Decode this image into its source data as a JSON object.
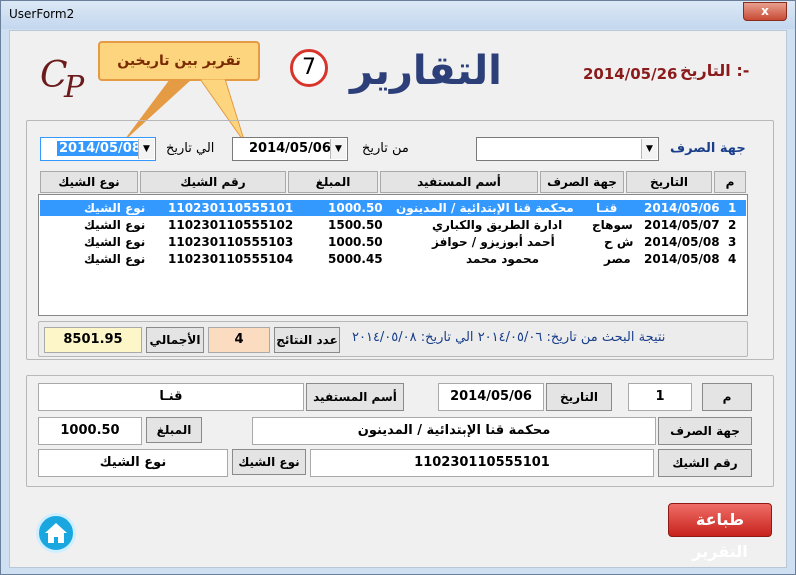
{
  "window": {
    "title": "UserForm2",
    "close_label": "x"
  },
  "header": {
    "logo_text": "CP",
    "callout": "تقرير بين تاريخين",
    "badge": "7",
    "title": "التقارير",
    "date_label": "التاريخ :-",
    "date_value": "2014/05/26"
  },
  "filters": {
    "expense_label": "جهة الصرف",
    "expense_value": "",
    "from_label": "من تاريخ",
    "from_value": "2014/05/06",
    "to_label": "الي تاريخ",
    "to_value": "2014/05/08"
  },
  "table": {
    "columns": [
      "م",
      "التاريخ",
      "جهة الصرف",
      "أسم المستفيد",
      "المبلغ",
      "رقم الشيك",
      "نوع الشيك"
    ],
    "rows": [
      {
        "n": "1",
        "date": "2014/05/06",
        "dept": "قنـا",
        "beneficiary": "محكمة قنا الإبتدائية / المدينون",
        "amount": "1000.50",
        "cheque": "110230110555101",
        "type": "نوع الشيك"
      },
      {
        "n": "2",
        "date": "2014/05/07",
        "dept": "سوهاج",
        "beneficiary": "ادارة الطريق والكباري",
        "amount": "1500.50",
        "cheque": "110230110555102",
        "type": "نوع الشيك"
      },
      {
        "n": "3",
        "date": "2014/05/08",
        "dept": "ش ح",
        "beneficiary": "أحمد أبوزيزو / حوافز",
        "amount": "1000.50",
        "cheque": "110230110555103",
        "type": "نوع الشيك"
      },
      {
        "n": "4",
        "date": "2014/05/08",
        "dept": "مصر",
        "beneficiary": "محمود محمد",
        "amount": "5000.45",
        "cheque": "110230110555104",
        "type": "نوع الشيك"
      }
    ]
  },
  "summary": {
    "result_text": "نتيجة البحث من تاريخ: ٢٠١٤/٠٥/٠٦ الي تاريخ: ٢٠١٤/٠٥/٠٨",
    "count_label": "عدد النتائج",
    "count_value": "4",
    "total_label": "الأجمالي",
    "total_value": "8501.95"
  },
  "detail": {
    "m_label": "م",
    "m_value": "1",
    "date_label": "التاريخ",
    "date_value": "2014/05/06",
    "beneficiary_label": "أسم المستفيد",
    "beneficiary_value": "قنـا",
    "dept_label": "جهة الصرف",
    "dept_value": "محكمة قنا الإبتدائية / المدينون",
    "amount_label": "المبلغ",
    "amount_value": "1000.50",
    "cheque_label": "رقم الشيك",
    "cheque_value": "110230110555101",
    "type_label": "نوع الشيك",
    "type_value": "نوع الشيك"
  },
  "actions": {
    "print_label": "طباعة التقرير",
    "home_icon": "home-icon"
  },
  "colors": {
    "accent": "#3399ff",
    "title": "#2c3f78",
    "date": "#8b1a1a",
    "print": "#c7221c"
  }
}
